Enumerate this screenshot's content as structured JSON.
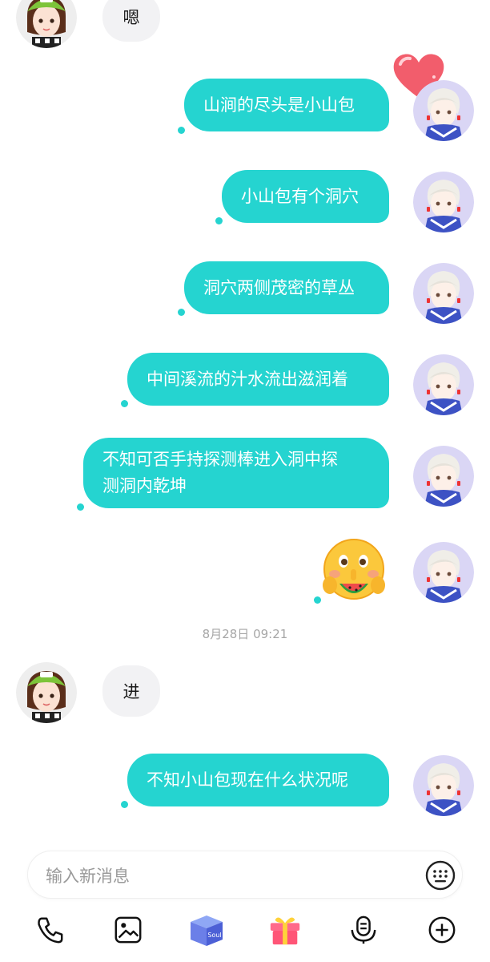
{
  "messages": [
    {
      "from": "other",
      "text": "嗯"
    },
    {
      "from": "me",
      "text": "山涧的尽头是小山包"
    },
    {
      "from": "me",
      "text": "小山包有个洞穴"
    },
    {
      "from": "me",
      "text": "洞穴两侧茂密的草丛"
    },
    {
      "from": "me",
      "text": "中间溪流的汁水流出滋润着"
    },
    {
      "from": "me",
      "lines": [
        "不知可否手持探测棒进入洞中探",
        "测洞内乾坤"
      ]
    },
    {
      "from": "me",
      "emoji": "face-eating-watermelon-shh"
    },
    {
      "from": "other",
      "text": "进"
    },
    {
      "from": "me",
      "text": "不知小山包现在什么状况呢"
    }
  ],
  "timestamp": "8月28日 09:21",
  "composer": {
    "placeholder": "输入新消息"
  },
  "toolbar": [
    "phone-icon",
    "image-icon",
    "soul-gift-box-icon",
    "gift-icon",
    "voice-icon",
    "add-icon"
  ],
  "colors": {
    "accent": "#25d4d0",
    "incoming_bubble": "#f2f2f4",
    "heart": "#f25d6c"
  }
}
